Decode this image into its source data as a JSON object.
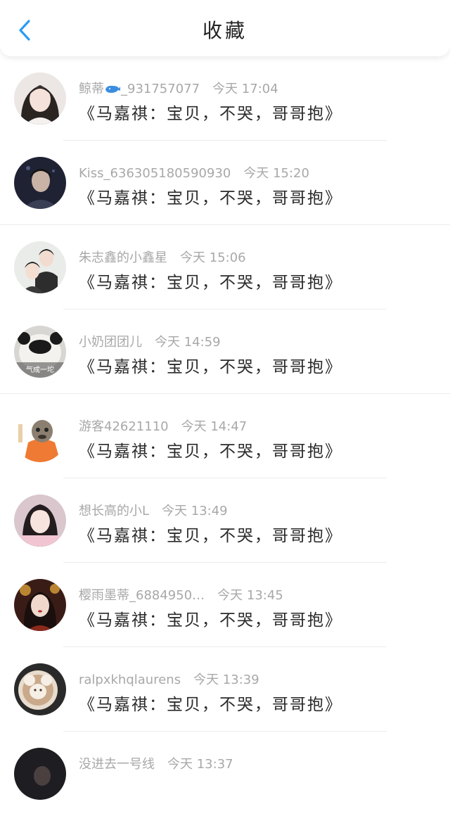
{
  "header": {
    "title": "收藏",
    "back_icon": "chevron-left-icon",
    "accent_color": "#2b9cf2"
  },
  "favorites": [
    {
      "username": "鲸蒂",
      "suffix": "_931757077",
      "time": "今天 17:04",
      "message": "《马嘉祺：宝贝，不哭，哥哥抱》",
      "emoji": "whale-icon"
    },
    {
      "username": "Kiss_636305180590930",
      "suffix": "",
      "time": "今天 15:20",
      "message": "《马嘉祺：宝贝，不哭，哥哥抱》"
    },
    {
      "username": "朱志鑫的小鑫星",
      "suffix": "",
      "time": "今天 15:06",
      "message": "《马嘉祺：宝贝，不哭，哥哥抱》"
    },
    {
      "username": "小奶团团儿",
      "suffix": "",
      "time": "今天 14:59",
      "message": "《马嘉祺：宝贝，不哭，哥哥抱》",
      "avatar_text": "气成一坨"
    },
    {
      "username": "游客42621110",
      "suffix": "",
      "time": "今天 14:47",
      "message": "《马嘉祺：宝贝，不哭，哥哥抱》"
    },
    {
      "username": "想长高的小L",
      "suffix": "",
      "time": "今天 13:49",
      "message": "《马嘉祺：宝贝，不哭，哥哥抱》"
    },
    {
      "username": "樱雨墨蒂_6884950…",
      "suffix": "",
      "time": "今天 13:45",
      "message": "《马嘉祺：宝贝，不哭，哥哥抱》"
    },
    {
      "username": "ralpxkhqlaurens",
      "suffix": "",
      "time": "今天 13:39",
      "message": "《马嘉祺：宝贝，不哭，哥哥抱》"
    },
    {
      "username": "没进去一号线",
      "suffix": "",
      "time": "今天 13:37",
      "message": ""
    }
  ]
}
